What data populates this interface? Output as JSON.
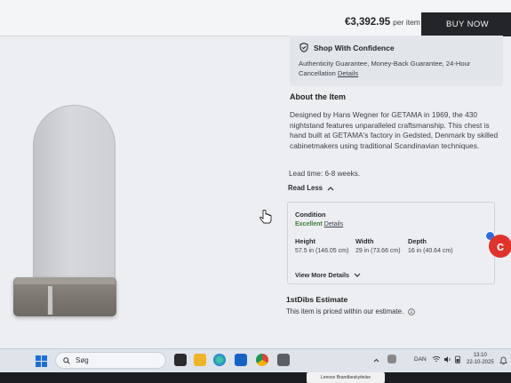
{
  "header": {
    "price": "€3,392.95",
    "price_unit": "per item",
    "buy_label": "BUY NOW"
  },
  "confidence": {
    "title": "Shop With Confidence",
    "text": "Authenticity Guarantee, Money-Back Guarantee, 24-Hour Cancellation",
    "link": "Details"
  },
  "about": {
    "title": "About the Item",
    "text": "Designed by Hans Wegner for GETAMA in 1969, the 430 nightstand features unparalleled craftsmanship. This chest is hand built at GETAMA's factory in Gedsted, Denmark by skilled cabinetmakers using traditional Scandinavian techniques.",
    "lead_time": "Lead time: 6-8 weeks.",
    "read_less": "Read Less"
  },
  "details": {
    "condition_label": "Condition",
    "condition_value": "Excellent",
    "condition_link": "Details",
    "height_label": "Height",
    "height_value": "57.5 in (146.05 cm)",
    "width_label": "Width",
    "width_value": "29 in (73.66 cm)",
    "depth_label": "Depth",
    "depth_value": "16 in (40.64 cm)",
    "view_more": "View More Details"
  },
  "estimate": {
    "title": "1stDibs Estimate",
    "text": "This item is priced within our estimate."
  },
  "chat": {
    "letter": "c"
  },
  "taskbar": {
    "search_placeholder": "Søg",
    "language": "DAN",
    "time": "13:10",
    "date": "22-10-2025"
  },
  "bezel": {
    "label": "Lenovo Brandbeskyttelse"
  },
  "colors": {
    "accent_dark": "#232529",
    "chat_red": "#e0332d",
    "excellent_green": "#3f7f3a"
  }
}
